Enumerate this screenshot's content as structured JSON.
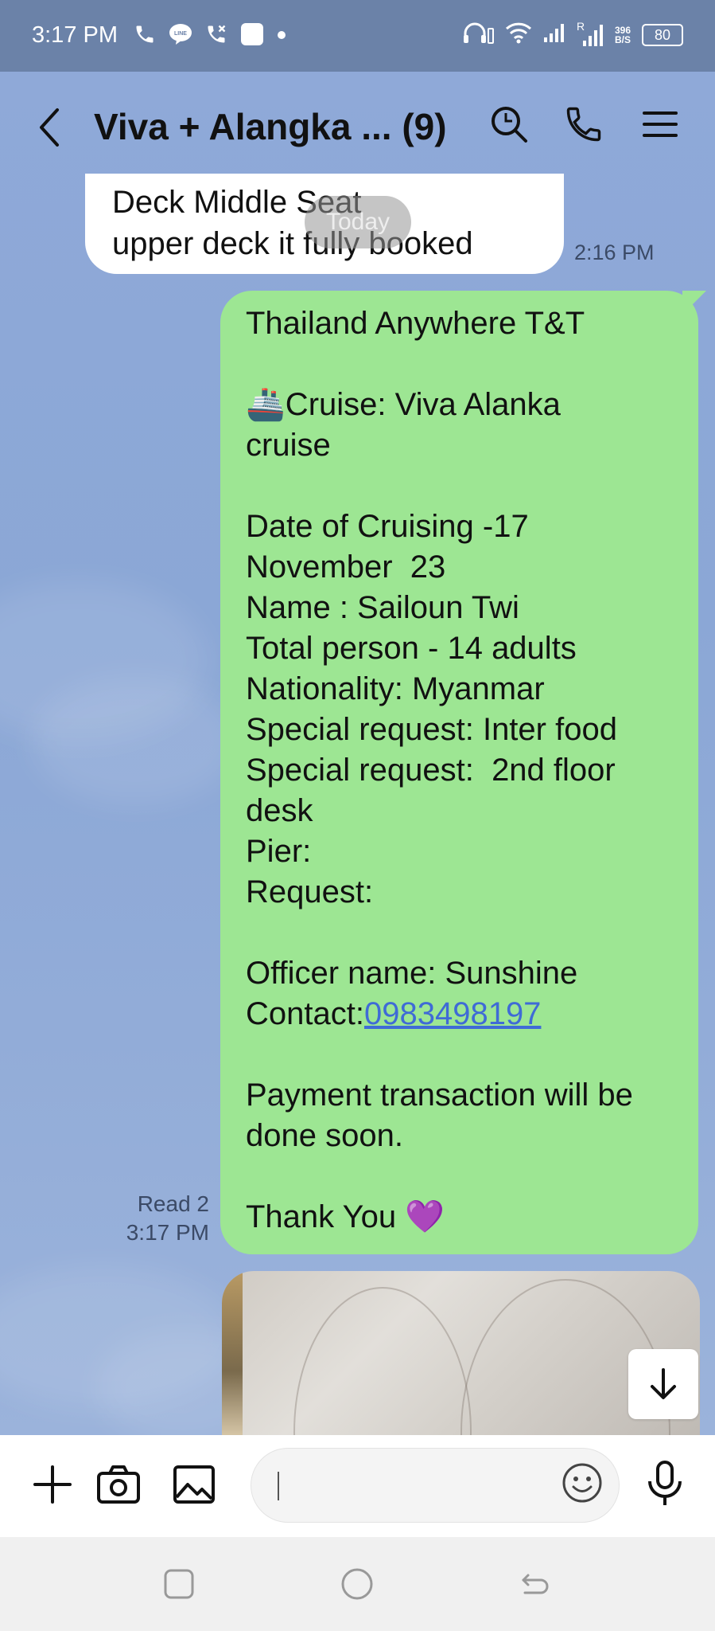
{
  "status_bar": {
    "time": "3:17 PM",
    "network_speed_value": "396",
    "network_speed_unit": "B/S",
    "roaming": "R",
    "battery": "80"
  },
  "header": {
    "title": "Viva + Alangka ... (9)"
  },
  "messages": {
    "incoming": {
      "lines": [
        "Deck Middle Seat",
        "upper deck it fully booked"
      ],
      "time": "2:16 PM"
    },
    "date_separator": "Today",
    "outgoing": {
      "lines": [
        "Thailand Anywhere T&T",
        "",
        "🚢Cruise: Viva Alanka",
        "cruise",
        "",
        "Date of Cruising -17",
        "November  23",
        "Name : Sailoun Twi",
        "Total person - 14 adults",
        "Nationality: Myanmar",
        "Special request: Inter food",
        "Special request:  2nd floor",
        "desk",
        "Pier:",
        "Request:",
        "",
        "Officer name: Sunshine"
      ],
      "contact_label": "Contact:",
      "contact_number": "0983498197",
      "lines_after": [
        "",
        "Payment transaction will be",
        "done soon.",
        "",
        "Thank You 💜"
      ],
      "read_status": "Read 2",
      "time": "3:17 PM"
    }
  },
  "input": {
    "placeholder": "",
    "value": ""
  },
  "colors": {
    "status_bar": "#6b82a8",
    "chat_background": "#8ba7d6",
    "outgoing_bubble": "#9de693",
    "incoming_bubble": "#ffffff",
    "link": "#3f6bd6"
  }
}
